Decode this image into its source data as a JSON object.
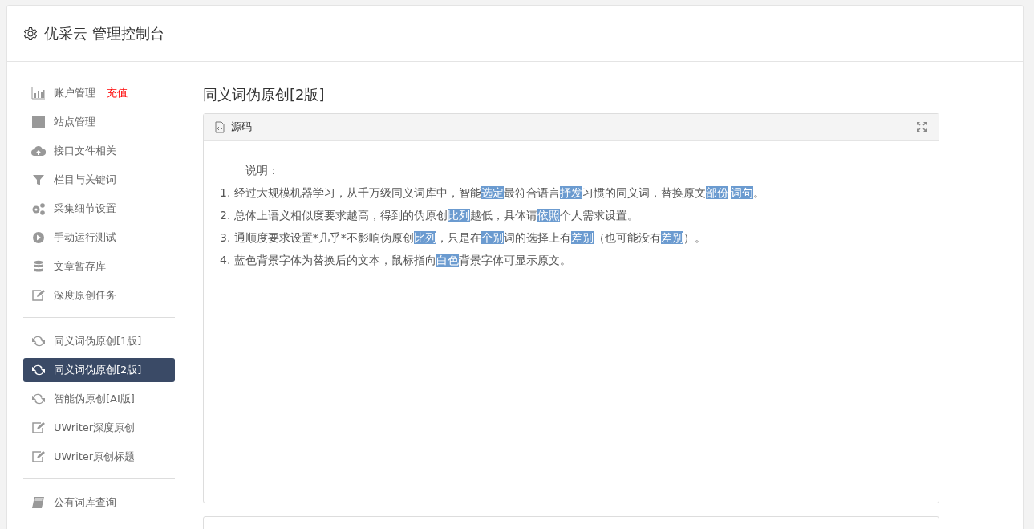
{
  "header": {
    "title": "优采云 管理控制台"
  },
  "sidebar": {
    "groups": [
      {
        "items": [
          {
            "label": "账户管理",
            "tag": "充值",
            "selected": false
          },
          {
            "label": "站点管理",
            "selected": false
          },
          {
            "label": "接口文件相关",
            "selected": false
          },
          {
            "label": "栏目与关键词",
            "selected": false
          },
          {
            "label": "采集细节设置",
            "selected": false
          },
          {
            "label": "手动运行测试",
            "selected": false
          },
          {
            "label": "文章暂存库",
            "selected": false
          },
          {
            "label": "深度原创任务",
            "selected": false
          }
        ]
      },
      {
        "items": [
          {
            "label": "同义词伪原创[1版]",
            "selected": false
          },
          {
            "label": "同义词伪原创[2版]",
            "selected": true
          },
          {
            "label": "智能伪原创[AI版]",
            "selected": false
          },
          {
            "label": "UWriter深度原创",
            "selected": false
          },
          {
            "label": "UWriter原创标题",
            "selected": false
          }
        ]
      },
      {
        "items": [
          {
            "label": "公有词库查询",
            "selected": false
          }
        ]
      }
    ]
  },
  "main": {
    "title": "同义词伪原创[2版]",
    "editor": {
      "toolbar_label": "源码",
      "heading": "说明：",
      "lines": [
        [
          {
            "text": "1. 经过大规模机器学习，从千万级同义词库中，智能",
            "highlighted": false
          },
          {
            "text": "选定",
            "highlighted": true
          },
          {
            "text": "最符合语言",
            "highlighted": false
          },
          {
            "text": "抒发",
            "highlighted": true
          },
          {
            "text": "习惯的同义词，替换原文",
            "highlighted": false
          },
          {
            "text": "部份",
            "highlighted": true
          },
          {
            "text": "词句",
            "highlighted": true
          },
          {
            "text": "。",
            "highlighted": false
          }
        ],
        [
          {
            "text": "2. 总体上语义相似度要求越高，得到的伪原创",
            "highlighted": false
          },
          {
            "text": "比列",
            "highlighted": true
          },
          {
            "text": "越低，具体请",
            "highlighted": false
          },
          {
            "text": "依照",
            "highlighted": true
          },
          {
            "text": "个人需求设置。",
            "highlighted": false
          }
        ],
        [
          {
            "text": "3. 通顺度要求设置*几乎*不影响伪原创",
            "highlighted": false
          },
          {
            "text": "比列",
            "highlighted": true
          },
          {
            "text": "，只是在",
            "highlighted": false
          },
          {
            "text": "个别",
            "highlighted": true
          },
          {
            "text": "词的选择上有",
            "highlighted": false
          },
          {
            "text": "差别",
            "highlighted": true
          },
          {
            "text": "（也可能没有",
            "highlighted": false
          },
          {
            "text": "差别",
            "highlighted": true
          },
          {
            "text": "）。",
            "highlighted": false
          }
        ],
        [
          {
            "text": "4. 蓝色背景字体为替换后的文本，鼠标指向",
            "highlighted": false
          },
          {
            "text": "白色",
            "highlighted": true
          },
          {
            "text": "背景字体可显示原文。",
            "highlighted": false
          }
        ]
      ]
    }
  }
}
